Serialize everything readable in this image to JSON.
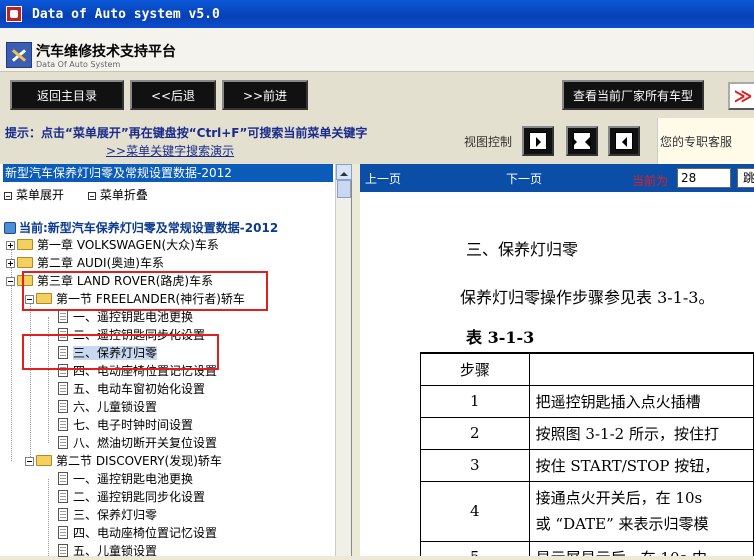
{
  "window": {
    "title": "Data of Auto system v5.0"
  },
  "brand": {
    "title": "汽车维修技术支持平台",
    "subtitle": "Data Of Auto System"
  },
  "toolbar": {
    "home": "返回主目录",
    "back": "<<后退",
    "forward": ">>前进",
    "all_models": "查看当前厂家所有车型",
    "more": "≫"
  },
  "hint": {
    "line1": "提示：点击“菜单展开”再在键盘按“Ctrl+F”可搜索当前菜单关键字",
    "link": ">>菜单关键字搜索演示"
  },
  "view_control": {
    "label": "视图控制"
  },
  "service": {
    "label": "您的专职客服"
  },
  "tree": {
    "header": "新型汽车保养灯归零及常规设置数据-2012",
    "expand": "菜单展开",
    "collapse": "菜单折叠",
    "current": "当前:新型汽车保养灯归零及常规设置数据-2012",
    "ch1": "第一章 VOLKSWAGEN(大众)车系",
    "ch2": "第二章 AUDI(奥迪)车系",
    "ch3": "第三章 LAND ROVER(路虎)车系",
    "sec1": "第一节 FREELANDER(神行者)轿车",
    "s1_items": [
      "一、遥控钥匙电池更换",
      "二、遥控钥匙同步化设置",
      "三、保养灯归零",
      "四、电动座椅位置记忆设置",
      "五、电动车窗初始化设置",
      "六、儿童锁设置",
      "七、电子时钟时间设置",
      "八、燃油切断开关复位设置"
    ],
    "sec2": "第二节 DISCOVERY(发现)轿车",
    "s2_items": [
      "一、遥控钥匙电池更换",
      "二、遥控钥匙同步化设置",
      "三、保养灯归零",
      "四、电动座椅位置记忆设置",
      "五、儿童锁设置"
    ]
  },
  "viewer": {
    "prev": "上一页",
    "next": "下一页",
    "current_label": "当前为",
    "page": "28",
    "go": "跳"
  },
  "document": {
    "heading": "三、保养灯归零",
    "para": "保养灯归零操作步骤参见表 3-1-3。",
    "caption": "表 3-1-3",
    "col_step": "步骤",
    "rows": [
      {
        "n": "1",
        "d": "把遥控钥匙插入点火插槽"
      },
      {
        "n": "2",
        "d": "按照图 3-1-2 所示，按住打"
      },
      {
        "n": "3",
        "d": "按住 START/STOP 按钮，"
      },
      {
        "n": "4",
        "d": "接通点火开关后，在 10s",
        "d2": "或 “DATE” 来表示归零模"
      },
      {
        "n": "5",
        "d": "显示屏显示后，在 10s 内"
      }
    ]
  }
}
